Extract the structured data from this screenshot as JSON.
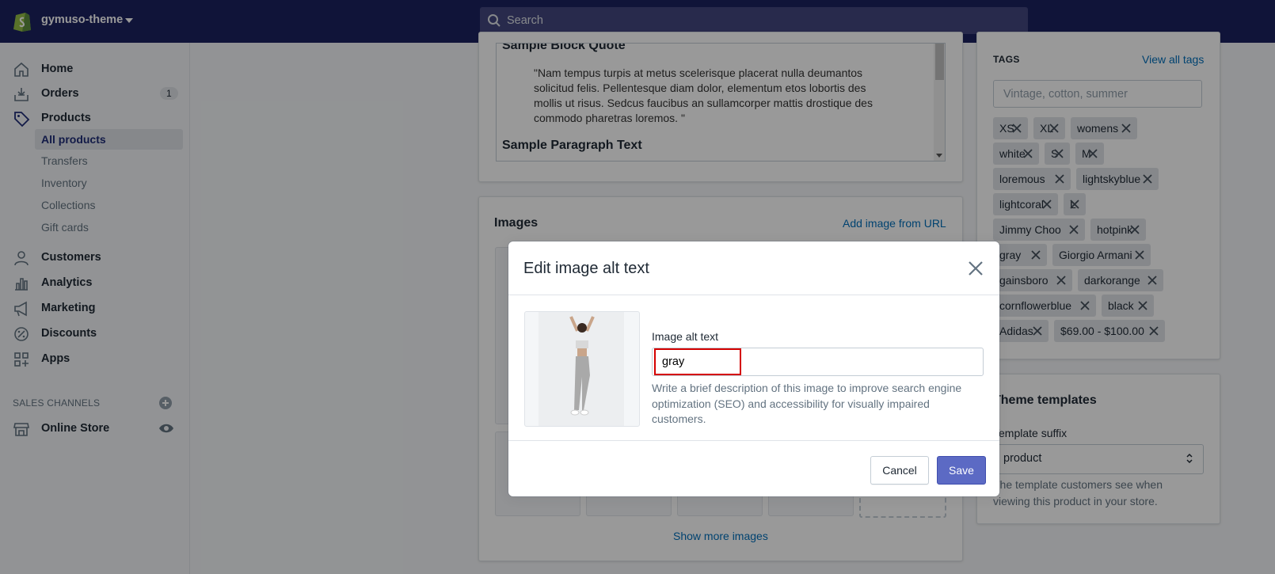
{
  "topbar": {
    "store_name": "gymuso-theme",
    "search_placeholder": "Search"
  },
  "sidebar": {
    "main": [
      {
        "label": "Home",
        "icon": "home-icon"
      },
      {
        "label": "Orders",
        "icon": "orders-icon",
        "badge": "1"
      },
      {
        "label": "Products",
        "icon": "tag-icon"
      }
    ],
    "products_sub": [
      "All products",
      "Transfers",
      "Inventory",
      "Collections",
      "Gift cards"
    ],
    "more": [
      {
        "label": "Customers",
        "icon": "person-icon"
      },
      {
        "label": "Analytics",
        "icon": "bar-chart-icon"
      },
      {
        "label": "Marketing",
        "icon": "megaphone-icon"
      },
      {
        "label": "Discounts",
        "icon": "discount-icon"
      },
      {
        "label": "Apps",
        "icon": "apps-icon"
      }
    ],
    "sales_channels_label": "SALES CHANNELS",
    "online_store": "Online Store"
  },
  "editor": {
    "heading1": "Sample Block Quote",
    "quote": "\"Nam tempus turpis at metus scelerisque placerat nulla deumantos solicitud felis. Pellentesque diam dolor, elementum etos lobortis des mollis ut risus. Sedcus faucibus an sullamcorper mattis drostique des commodo pharetras loremos. \"",
    "heading2": "Sample Paragraph Text"
  },
  "images": {
    "title": "Images",
    "add_from_url": "Add image from URL",
    "show_more": "Show more images"
  },
  "tags": {
    "heading": "TAGS",
    "view_all": "View all tags",
    "input_placeholder": "Vintage, cotton, summer",
    "items": [
      "XS",
      "XL",
      "womens",
      "white",
      "S",
      "M",
      "loremous",
      "lightskyblue",
      "lightcoral",
      "L",
      "Jimmy Choo",
      "hotpink",
      "gray",
      "Giorgio Armani",
      "gainsboro",
      "darkorange",
      "cornflowerblue",
      "black",
      "Adidas",
      "$69.00 - $100.00"
    ]
  },
  "theme_templates": {
    "title": "Theme templates",
    "suffix_label": "Template suffix",
    "suffix_value": "product",
    "help": "The template customers see when viewing this product in your store."
  },
  "modal": {
    "title": "Edit image alt text",
    "field_label": "Image alt text",
    "field_value": "gray",
    "help": "Write a brief description of this image to improve search engine optimization (SEO) and accessibility for visually impaired customers.",
    "cancel": "Cancel",
    "save": "Save"
  },
  "colors": {
    "topbar": "#1c2260",
    "primary": "#5c6ac4",
    "link": "#006fbb",
    "highlight_box": "#d40000"
  }
}
